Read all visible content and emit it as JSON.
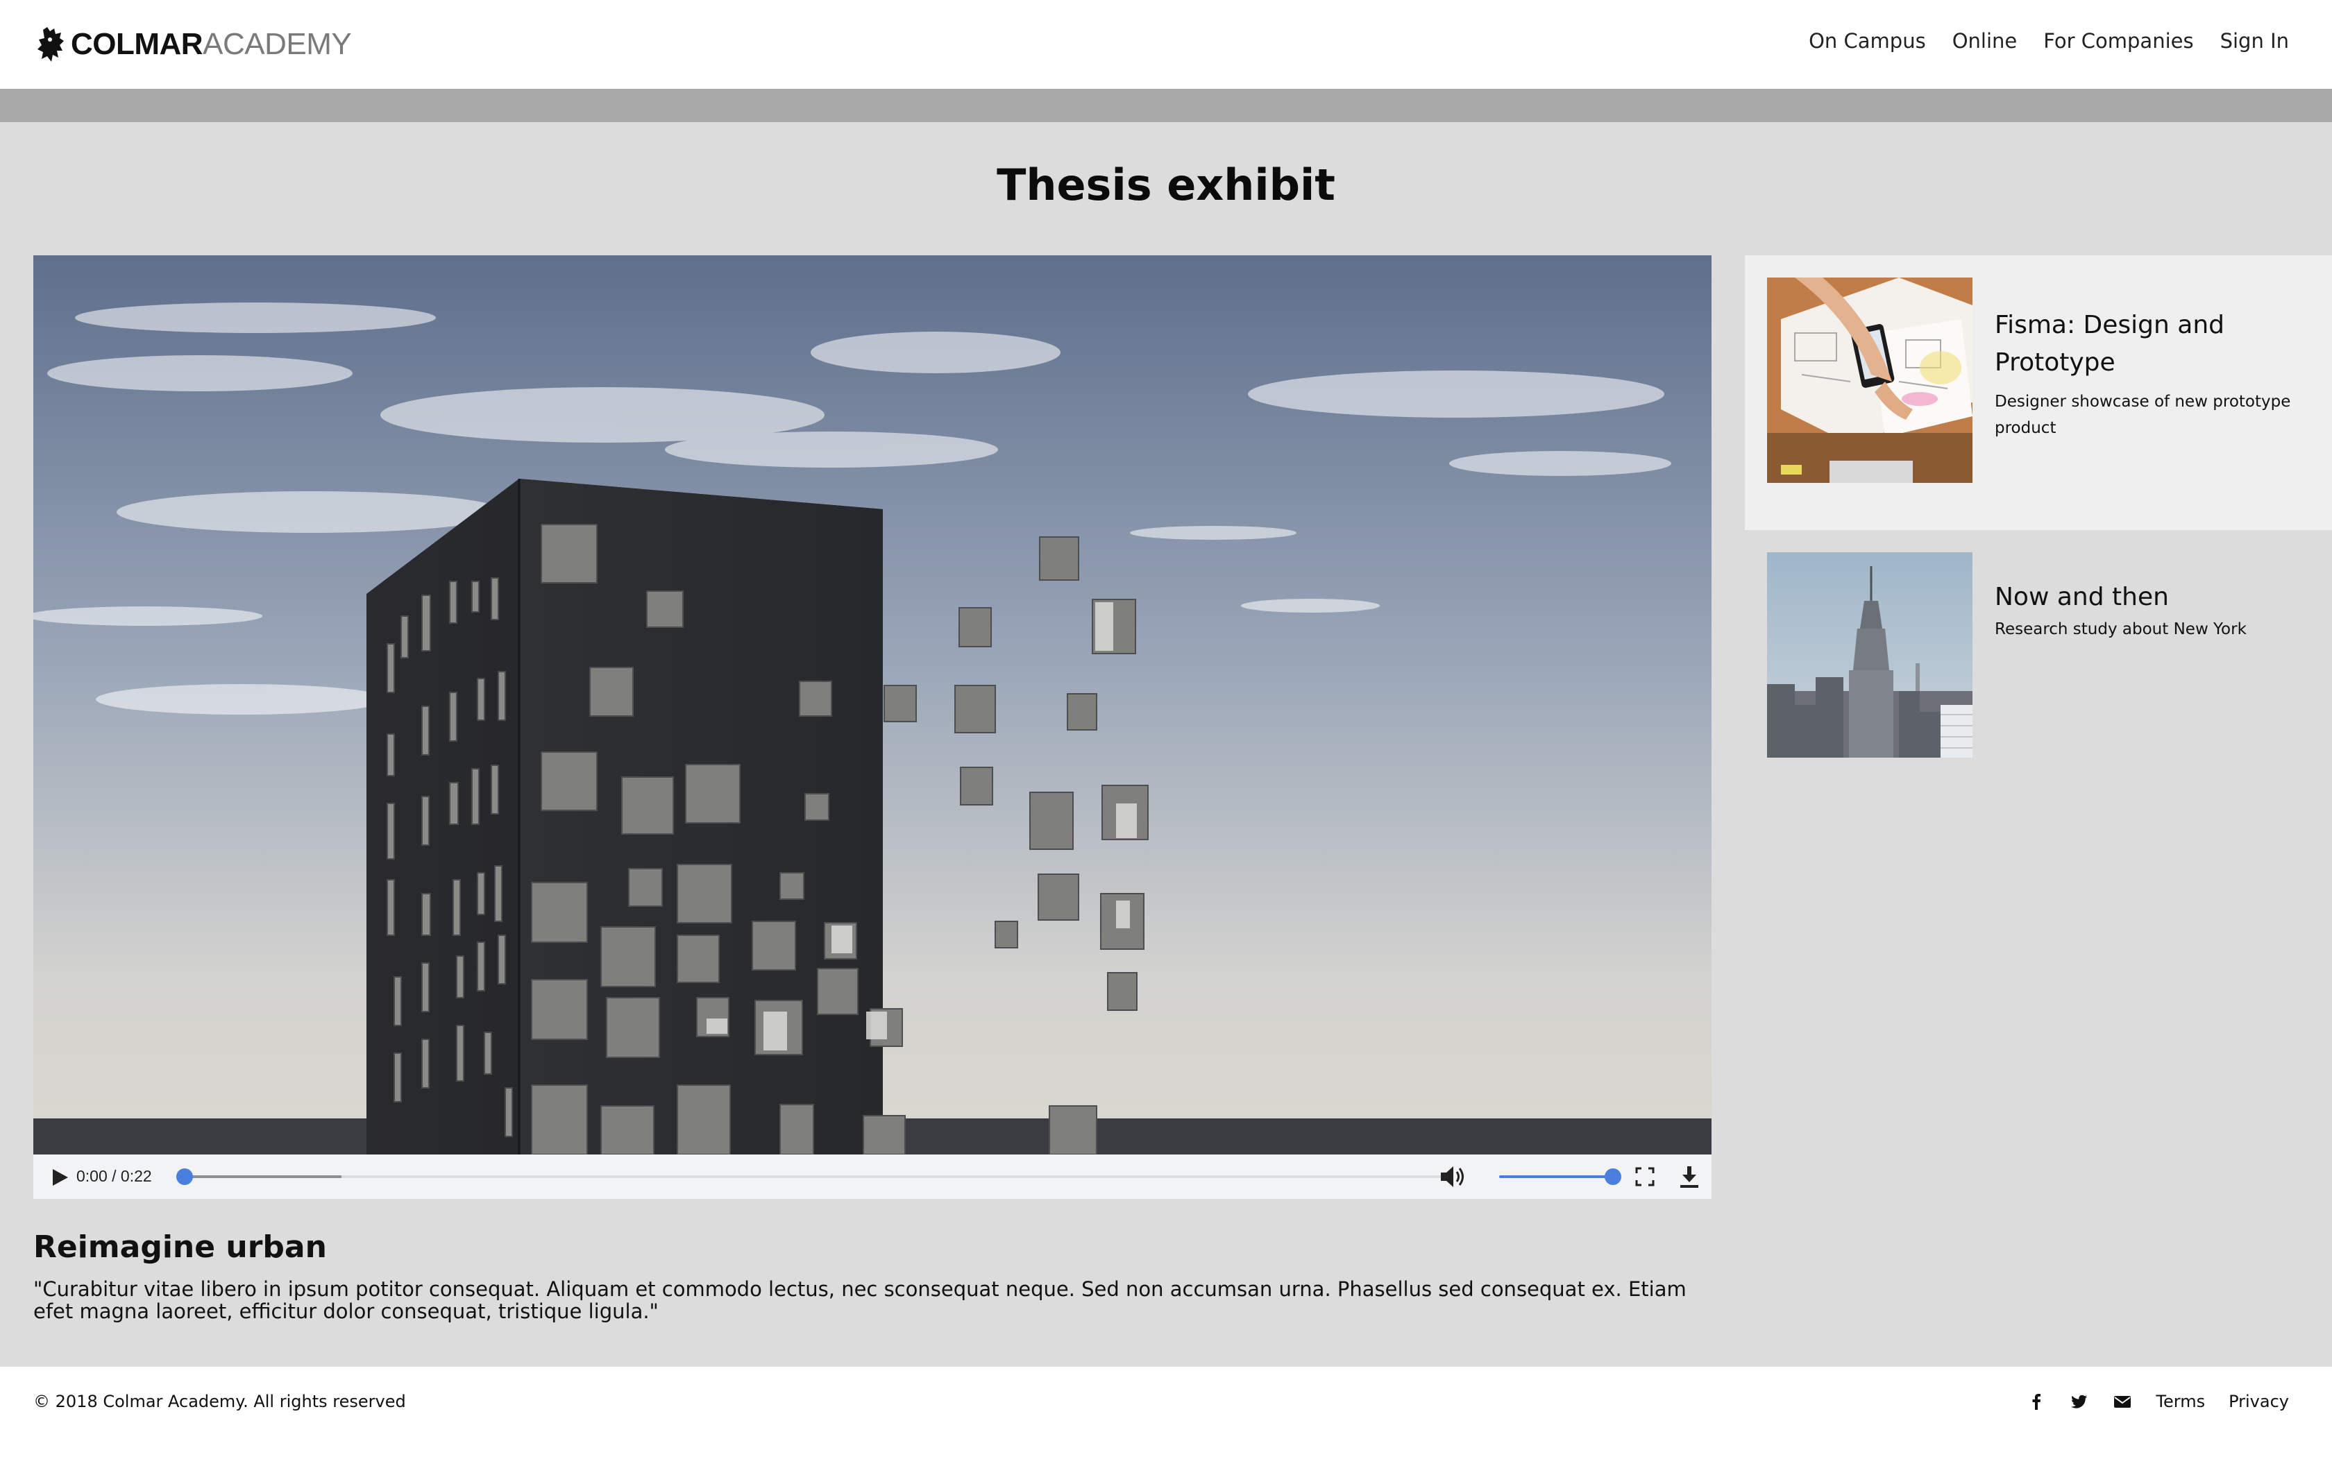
{
  "brand": {
    "name_bold": "COLMAR",
    "name_light": "ACADEMY",
    "logo_icon": "lion-crest-icon"
  },
  "nav": {
    "items": [
      {
        "label": "On Campus"
      },
      {
        "label": "Online"
      },
      {
        "label": "For Companies"
      },
      {
        "label": "Sign In"
      }
    ]
  },
  "page": {
    "title": "Thesis exhibit"
  },
  "video": {
    "current_time": "0:00",
    "duration": "0:22",
    "time_display": "0:00 / 0:22",
    "playback_progress": 0,
    "buffered_fraction": 0.13,
    "volume_level": 1.0,
    "icons": [
      "play-icon",
      "volume-icon",
      "fullscreen-icon",
      "download-icon"
    ],
    "title": "Reimagine urban",
    "description": "\"Curabitur vitae libero in ipsum potitor consequat. Aliquam et commodo lectus, nec sconsequat neque. Sed non accumsan urna. Phasellus sed consequat ex. Etiam efet magna laoreet, efficitur dolor consequat, tristique ligula.\""
  },
  "sidebar": {
    "cards": [
      {
        "title": "Fisma: Design and Prototype",
        "subtitle": "Designer showcase of new prototype product",
        "active": true
      },
      {
        "title": "Now and then",
        "subtitle": "Research study about New York",
        "active": false
      }
    ]
  },
  "footer": {
    "copyright": "© 2018 Colmar Academy. All rights reserved",
    "social_icons": [
      "facebook-icon",
      "twitter-icon",
      "email-icon"
    ],
    "links": [
      {
        "label": "Terms"
      },
      {
        "label": "Privacy"
      }
    ]
  },
  "colors": {
    "accent": "#4a7fe0",
    "page_bg": "#dcdcdc",
    "strip": "#a9a9a9",
    "active_card_bg": "#efefef"
  }
}
